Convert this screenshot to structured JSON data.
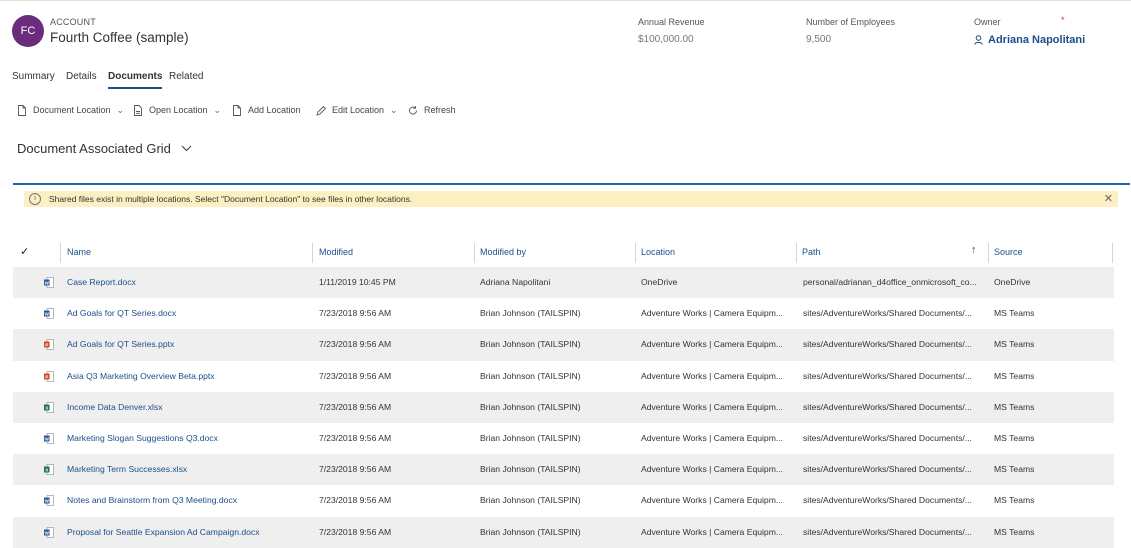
{
  "header": {
    "avatar_initials": "FC",
    "avatar_color": "#6b2c7e",
    "entity_type": "ACCOUNT",
    "record_title": "Fourth Coffee (sample)",
    "fields": [
      {
        "label": "Annual Revenue",
        "value": "$100,000.00"
      },
      {
        "label": "Number of Employees",
        "value": "9,500"
      },
      {
        "label": "Owner",
        "value": "Adriana Napolitani",
        "required_marker": "*"
      }
    ]
  },
  "tabs": [
    {
      "label": "Summary",
      "active": false
    },
    {
      "label": "Details",
      "active": false
    },
    {
      "label": "Documents",
      "active": true
    },
    {
      "label": "Related",
      "active": false
    }
  ],
  "toolbar": {
    "document_location": "Document Location",
    "open_location": "Open Location",
    "add_location": "Add Location",
    "edit_location": "Edit Location",
    "refresh": "Refresh"
  },
  "grid": {
    "title": "Document Associated Grid",
    "notice": "Shared files exist in multiple locations. Select \"Document Location\" to see files in other locations.",
    "columns": [
      "Name",
      "Modified",
      "Modified by",
      "Location",
      "Path",
      "Source"
    ],
    "rows": [
      {
        "icon": "word-icon",
        "name": "Case Report.docx",
        "modified": "1/11/2019 10:45 PM",
        "modified_by": "Adriana Napolitani",
        "location": "OneDrive",
        "path": "personal/adrianan_d4office_onmicrosoft_co...",
        "source": "OneDrive"
      },
      {
        "icon": "word-icon",
        "name": "Ad Goals for QT Series.docx",
        "modified": "7/23/2018 9:56 AM",
        "modified_by": "Brian Johnson (TAILSPIN)",
        "location": "Adventure Works | Camera Equipm...",
        "path": "sites/AdventureWorks/Shared Documents/...",
        "source": "MS Teams"
      },
      {
        "icon": "powerpoint-icon",
        "name": "Ad Goals for QT Series.pptx",
        "modified": "7/23/2018 9:56 AM",
        "modified_by": "Brian Johnson (TAILSPIN)",
        "location": "Adventure Works | Camera Equipm...",
        "path": "sites/AdventureWorks/Shared Documents/...",
        "source": "MS Teams"
      },
      {
        "icon": "powerpoint-icon",
        "name": "Asia Q3 Marketing Overview Beta.pptx",
        "modified": "7/23/2018 9:56 AM",
        "modified_by": "Brian Johnson (TAILSPIN)",
        "location": "Adventure Works | Camera Equipm...",
        "path": "sites/AdventureWorks/Shared Documents/...",
        "source": "MS Teams"
      },
      {
        "icon": "excel-icon",
        "name": "Income Data Denver.xlsx",
        "modified": "7/23/2018 9:56 AM",
        "modified_by": "Brian Johnson (TAILSPIN)",
        "location": "Adventure Works | Camera Equipm...",
        "path": "sites/AdventureWorks/Shared Documents/...",
        "source": "MS Teams"
      },
      {
        "icon": "word-icon",
        "name": "Marketing Slogan Suggestions Q3.docx",
        "modified": "7/23/2018 9:56 AM",
        "modified_by": "Brian Johnson (TAILSPIN)",
        "location": "Adventure Works | Camera Equipm...",
        "path": "sites/AdventureWorks/Shared Documents/...",
        "source": "MS Teams"
      },
      {
        "icon": "excel-icon",
        "name": "Marketing Term Successes.xlsx",
        "modified": "7/23/2018 9:56 AM",
        "modified_by": "Brian Johnson (TAILSPIN)",
        "location": "Adventure Works | Camera Equipm...",
        "path": "sites/AdventureWorks/Shared Documents/...",
        "source": "MS Teams"
      },
      {
        "icon": "word-icon",
        "name": "Notes and Brainstorm from Q3 Meeting.docx",
        "modified": "7/23/2018 9:56 AM",
        "modified_by": "Brian Johnson (TAILSPIN)",
        "location": "Adventure Works | Camera Equipm...",
        "path": "sites/AdventureWorks/Shared Documents/...",
        "source": "MS Teams"
      },
      {
        "icon": "word-icon",
        "name": "Proposal for Seattle Expansion Ad Campaign.docx",
        "modified": "7/23/2018 9:56 AM",
        "modified_by": "Brian Johnson (TAILSPIN)",
        "location": "Adventure Works | Camera Equipm...",
        "path": "sites/AdventureWorks/Shared Documents/...",
        "source": "MS Teams"
      }
    ]
  },
  "colors": {
    "accent": "#1b4f8a",
    "grid_topline": "#2266b3",
    "notice_bg": "#fcefc1",
    "word": "#2b579a",
    "excel": "#217346",
    "powerpoint": "#d24726"
  }
}
